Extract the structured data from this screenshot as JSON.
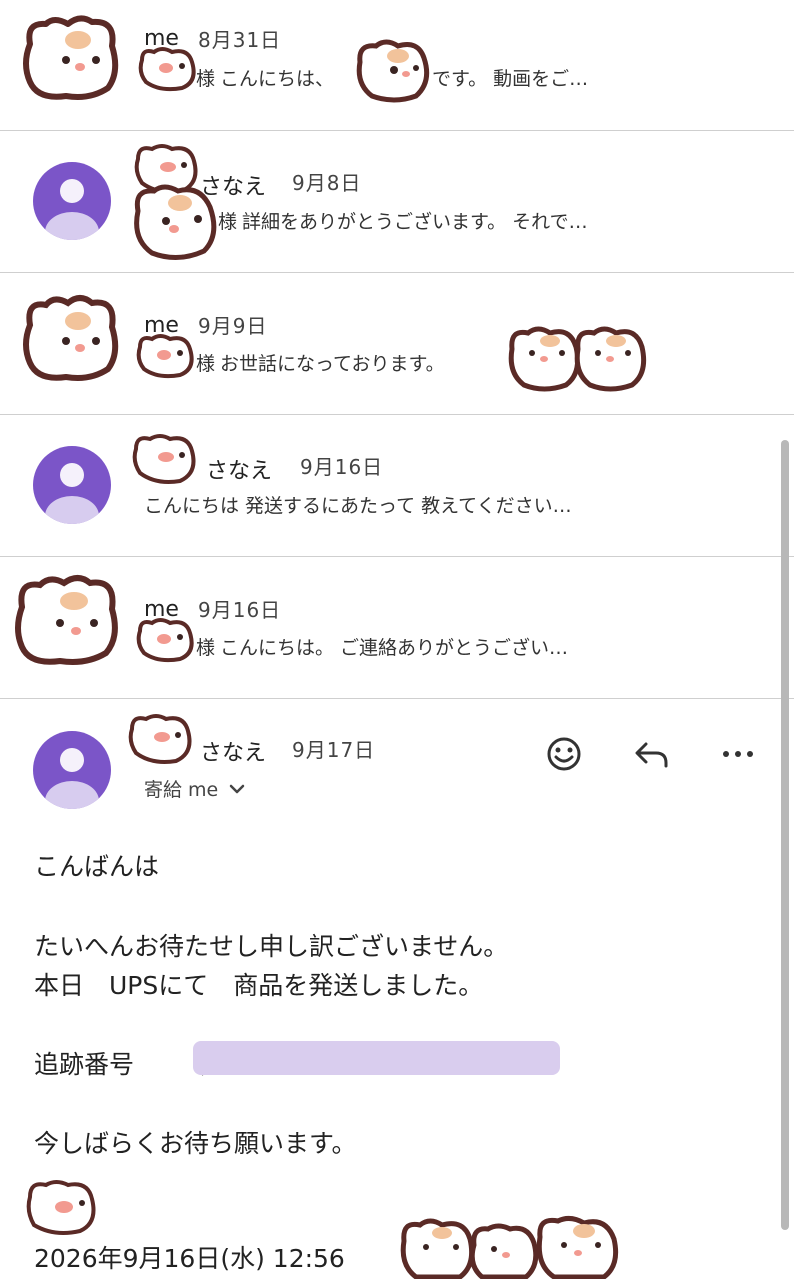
{
  "messages": [
    {
      "sender": "me",
      "date": "8月31日",
      "snippet_prefix": "様",
      "snippet": "こんにちは、",
      "snippet_tail": "です。 動画をご…"
    },
    {
      "sender": "さなえ",
      "date": "9月8日",
      "snippet_prefix": "様",
      "snippet": "詳細をありがとうございます。 それで…"
    },
    {
      "sender": "me",
      "date": "9月9日",
      "snippet_prefix": "様",
      "snippet": "お世話になっております。"
    },
    {
      "sender": "さなえ",
      "date": "9月16日",
      "snippet": "こんにちは 発送するにあたって 教えてください…"
    },
    {
      "sender": "me",
      "date": "9月16日",
      "snippet_prefix": "様",
      "snippet": "こんにちは。 ご連絡ありがとうござい…"
    }
  ],
  "open_message": {
    "sender": "さなえ",
    "date": "9月17日",
    "recipients": "寄給 me",
    "body": {
      "greeting": "こんばんは",
      "line1": "たいへんお待たせし申し訳ございません。",
      "line2": "本日　UPSにて　商品を発送しました。",
      "tracking_label": "追跡番号",
      "tracking_open": "（",
      "closing": "今しばらくお待ち願います。",
      "timestamp": "2026年9月16日(水) 12:56"
    }
  },
  "icons": {
    "emoji": "smiley-icon",
    "reply": "reply-icon",
    "more": "more-icon",
    "chevron": "chevron-down-icon"
  },
  "colors": {
    "avatar": "#7b55c8",
    "redaction": "#d9cdee",
    "divider": "#cfcfcf"
  }
}
